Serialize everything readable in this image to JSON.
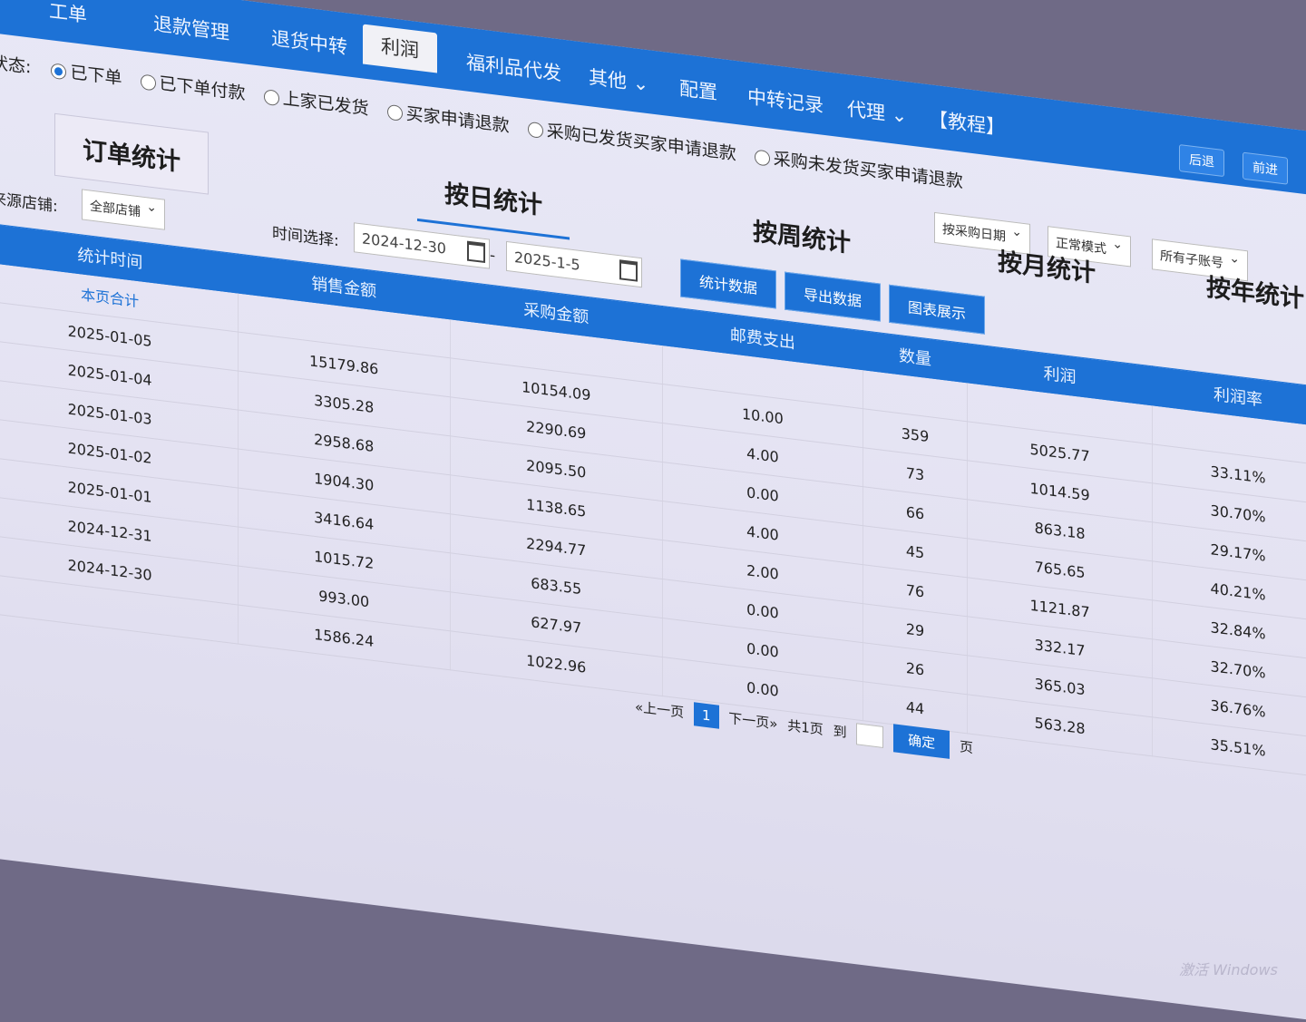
{
  "nav": {
    "items": [
      "工单",
      "退款管理",
      "退货中转",
      "利润",
      "福利品代发",
      "其他",
      "配置",
      "中转记录",
      "代理",
      "【教程】"
    ],
    "active": "利润",
    "back_label": "后退",
    "forward_label": "前进"
  },
  "status": {
    "label": "状态:",
    "options": [
      "已下单",
      "已下单付款",
      "上家已发货",
      "买家申请退款",
      "采购已发货买家申请退款",
      "采购未发货买家申请退款"
    ],
    "selected": "已下单"
  },
  "selects": {
    "date_type": "按采购日期",
    "mode": "正常模式",
    "account": "所有子账号"
  },
  "stat_tabs": [
    "订单统计",
    "按日统计",
    "按周统计",
    "按月统计",
    "按年统计"
  ],
  "active_tab": "按日统计",
  "filters": {
    "store_label": "来源店铺:",
    "store_value": "全部店铺",
    "time_label": "时间选择:",
    "date_from": "2024-12-30",
    "date_to": "2025-1-5",
    "range_sep": "-"
  },
  "actions": [
    "统计数据",
    "导出数据",
    "图表展示"
  ],
  "table": {
    "headers": [
      "统计时间",
      "销售金额",
      "采购金额",
      "邮费支出",
      "数量",
      "利润",
      "利润率"
    ],
    "total_label": "本页合计",
    "rows": [
      [
        "2025-01-05",
        "15179.86",
        "10154.09",
        "10.00",
        "359",
        "5025.77",
        "33.11%"
      ],
      [
        "2025-01-04",
        "3305.28",
        "2290.69",
        "4.00",
        "73",
        "1014.59",
        "30.70%"
      ],
      [
        "2025-01-03",
        "2958.68",
        "2095.50",
        "0.00",
        "66",
        "863.18",
        "29.17%"
      ],
      [
        "2025-01-02",
        "1904.30",
        "1138.65",
        "4.00",
        "45",
        "765.65",
        "40.21%"
      ],
      [
        "2025-01-01",
        "3416.64",
        "2294.77",
        "2.00",
        "76",
        "1121.87",
        "32.84%"
      ],
      [
        "2024-12-31",
        "1015.72",
        "683.55",
        "0.00",
        "29",
        "332.17",
        "32.70%"
      ],
      [
        "2024-12-30",
        "993.00",
        "627.97",
        "0.00",
        "26",
        "365.03",
        "36.76%"
      ],
      [
        "",
        "1586.24",
        "1022.96",
        "0.00",
        "44",
        "563.28",
        "35.51%"
      ]
    ]
  },
  "pager": {
    "prev": "«上一页",
    "current": "1",
    "next": "下一页»",
    "total": "共1页",
    "goto": "到",
    "confirm": "确定",
    "page_unit": "页"
  },
  "watermark": "激活 Windows"
}
